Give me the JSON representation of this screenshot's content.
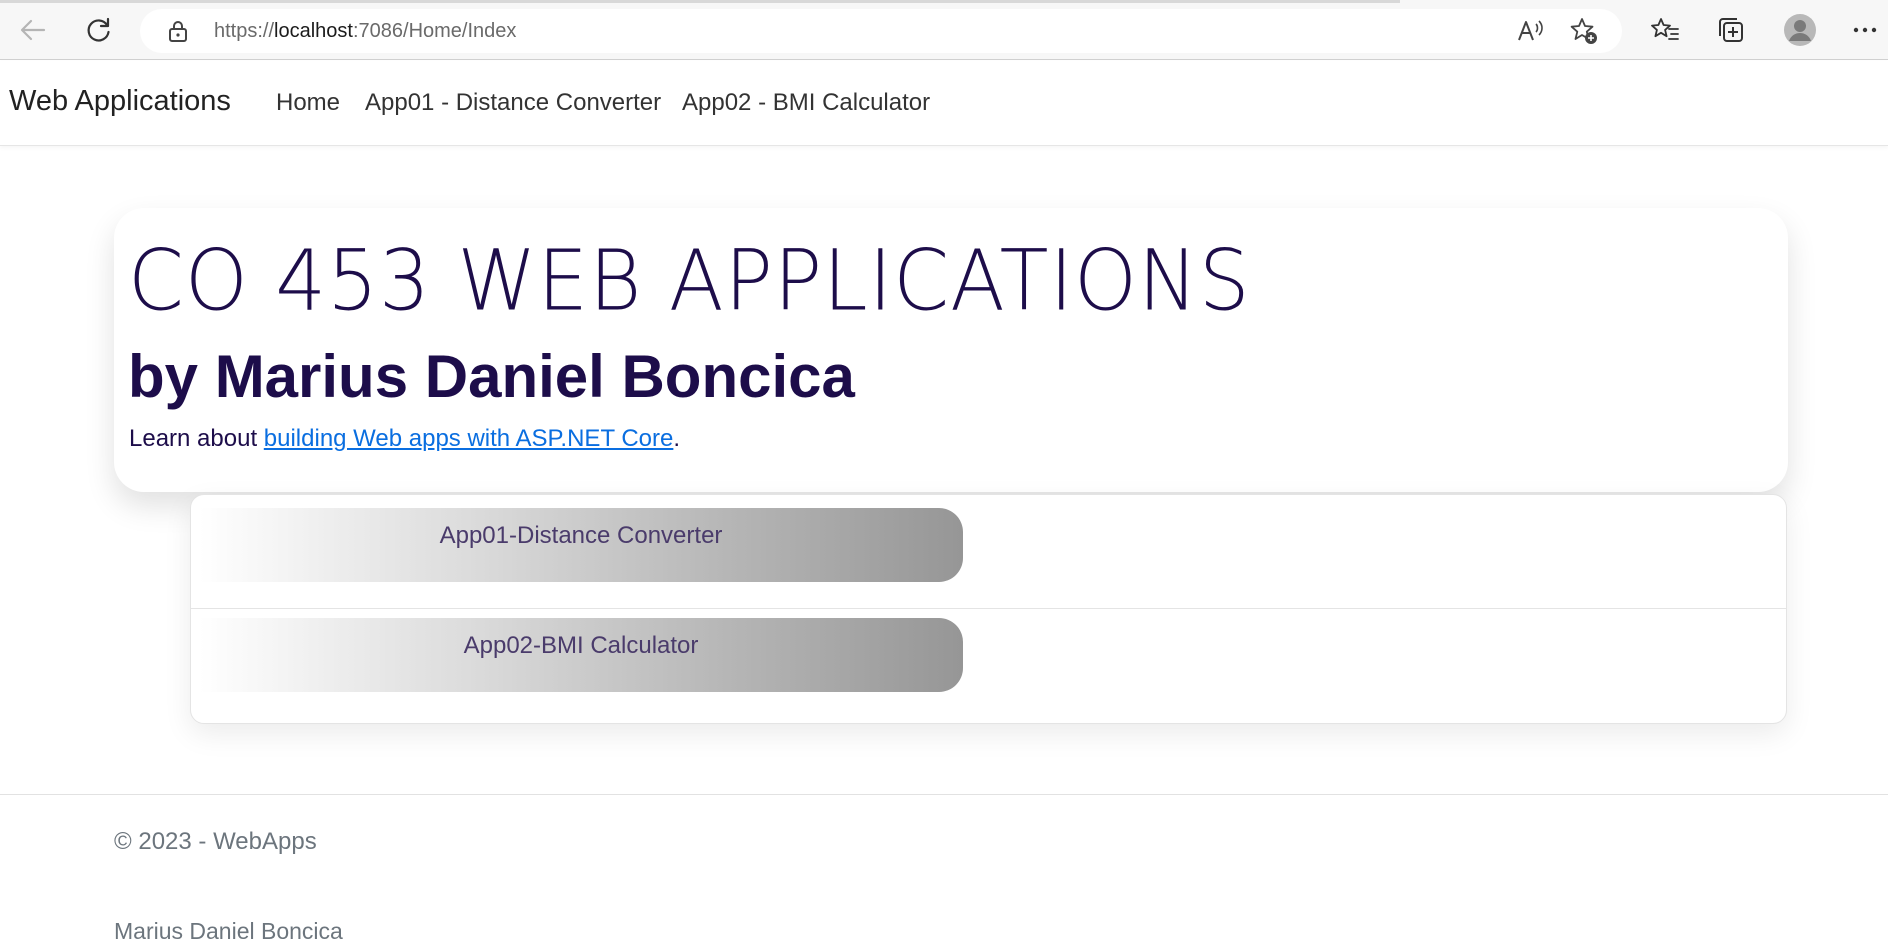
{
  "browser": {
    "url_prefix": "https://",
    "url_host": "localhost",
    "url_rest": ":7086/Home/Index"
  },
  "navbar": {
    "brand": "Web Applications",
    "links": [
      {
        "label": "Home"
      },
      {
        "label": "App01 - Distance Converter"
      },
      {
        "label": "App02 - BMI Calculator"
      }
    ]
  },
  "hero": {
    "title": "CO 453 WEB APPLICATIONS",
    "subtitle": "by Marius Daniel Boncica",
    "learn_prefix": "Learn about ",
    "learn_link": "building Web apps with ASP.NET Core",
    "learn_suffix": "."
  },
  "apps": [
    {
      "label": "App01-Distance Converter"
    },
    {
      "label": "App02-BMI Calculator"
    }
  ],
  "footer": {
    "copyright": "© 2023 - WebApps",
    "author": "Marius Daniel Boncica"
  },
  "colors": {
    "heading": "#1d0d4a",
    "link": "#0a6ee0",
    "muted": "#6c757d"
  }
}
